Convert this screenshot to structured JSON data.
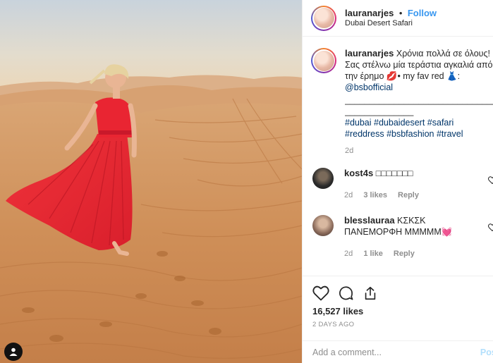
{
  "photo": {
    "alt": "Woman in red dress in desert dunes",
    "badge_icon": "user-tag-icon"
  },
  "header": {
    "username": "lauranarjes",
    "dot": "•",
    "follow_label": "Follow",
    "location": "Dubai Desert Safari"
  },
  "caption": {
    "username": "lauranarjes",
    "text_1": "Χρόνια πολλά σε όλους! Σας στέλνω μία τεράστια αγκαλιά από την έρημο 💋• my fav red 👗:",
    "mention": "@bsbofficial",
    "separator_1": "________________________________",
    "separator_2": "______________",
    "hashtags": [
      "#dubai",
      "#dubaidesert",
      "#safari",
      "#reddress",
      "#bsbfashion",
      "#travel"
    ],
    "age": "2d"
  },
  "comments": [
    {
      "username": "kost4s",
      "text": "□□□□□□□",
      "age": "2d",
      "likes": "3 likes",
      "reply": "Reply"
    },
    {
      "username": "blesslauraa",
      "text": "ΚΣΚΣΚ ΠΑΝΕΜΟΡΦΗ ΜΜΜΜΜ💓",
      "age": "2d",
      "likes": "1 like",
      "reply": "Reply"
    }
  ],
  "actions": {
    "like_icon": "heart-icon",
    "comment_icon": "comment-icon",
    "share_icon": "share-icon",
    "likes_count": "16,527 likes",
    "date": "2 DAYS AGO"
  },
  "add_comment": {
    "placeholder": "Add a comment...",
    "post_label": "Post"
  },
  "colors": {
    "link_blue": "#3897f0",
    "hashtag": "#003569",
    "muted": "#8e8e8e",
    "border": "#efefef"
  }
}
